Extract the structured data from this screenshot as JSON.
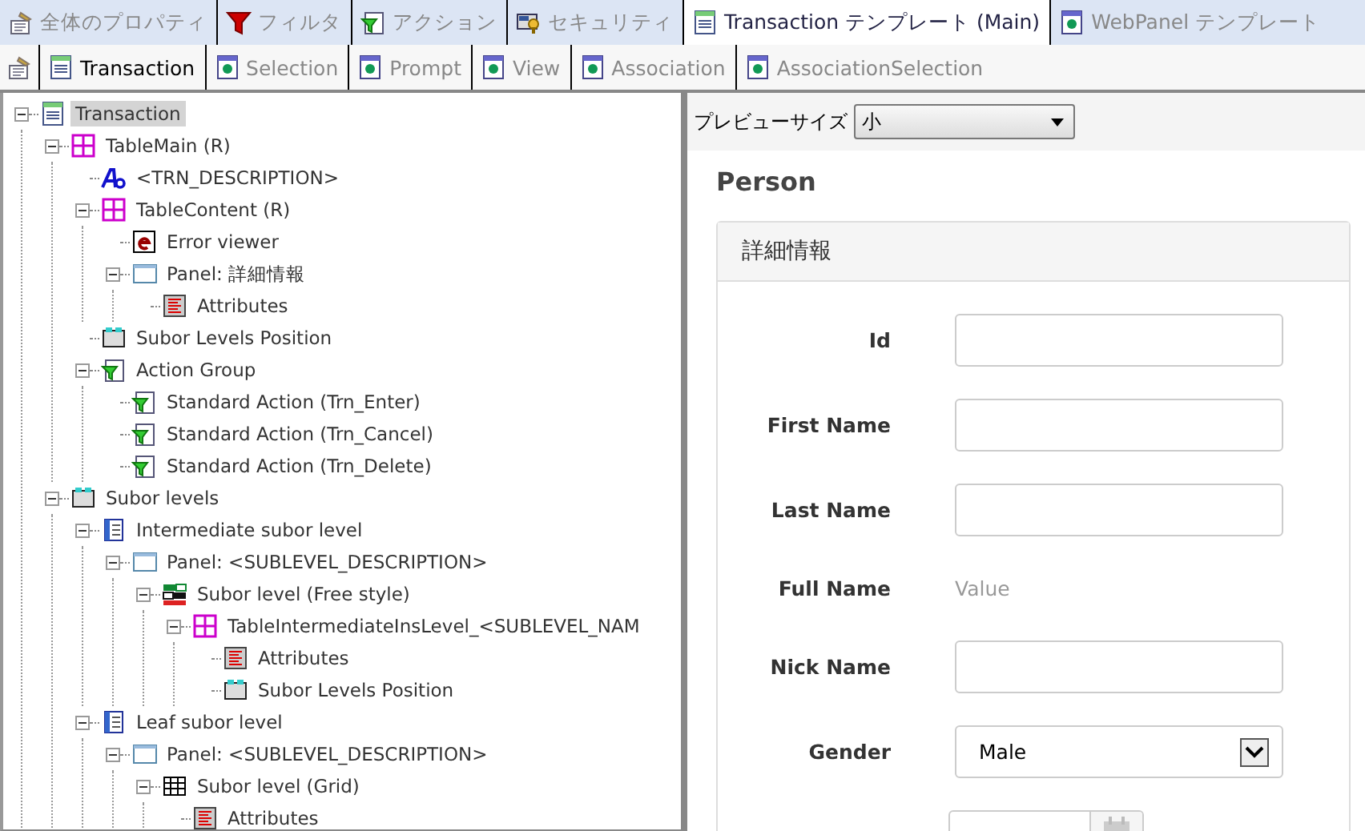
{
  "top_tabs": [
    {
      "label": "全体のプロパティ",
      "kind": "properties",
      "selected": false
    },
    {
      "label": "フィルタ",
      "kind": "filter",
      "selected": false
    },
    {
      "label": "アクション",
      "kind": "action",
      "selected": false
    },
    {
      "label": "セキュリティ",
      "kind": "security",
      "selected": false
    },
    {
      "label": "Transaction テンプレート (Main)",
      "kind": "transaction",
      "selected": true
    },
    {
      "label": "WebPanel テンプレート",
      "kind": "pattern",
      "selected": false
    }
  ],
  "sub_tabs": [
    {
      "label": "Transaction",
      "kind": "transaction",
      "selected": true
    },
    {
      "label": "Selection",
      "kind": "pattern",
      "selected": false
    },
    {
      "label": "Prompt",
      "kind": "pattern",
      "selected": false
    },
    {
      "label": "View",
      "kind": "pattern",
      "selected": false
    },
    {
      "label": "Association",
      "kind": "pattern",
      "selected": false
    },
    {
      "label": "AssociationSelection",
      "kind": "pattern",
      "selected": false
    }
  ],
  "tree": [
    {
      "label": "Transaction",
      "kind": "transaction",
      "selected": true,
      "expanded": true,
      "children": [
        {
          "label": "TableMain (R)",
          "kind": "table",
          "selected": false,
          "expanded": true,
          "children": [
            {
              "label": "<TRN_DESCRIPTION>",
              "kind": "textblock",
              "selected": false
            },
            {
              "label": "TableContent (R)",
              "kind": "table",
              "selected": false,
              "expanded": true,
              "children": [
                {
                  "label": "Error viewer",
                  "kind": "error",
                  "selected": false
                },
                {
                  "label": "Panel: 詳細情報",
                  "kind": "panel",
                  "selected": false,
                  "expanded": true,
                  "children": [
                    {
                      "label": "Attributes",
                      "kind": "attributes",
                      "selected": false
                    }
                  ]
                }
              ]
            },
            {
              "label": "Subor Levels Position",
              "kind": "levels",
              "selected": false
            },
            {
              "label": "Action Group",
              "kind": "action",
              "selected": false,
              "expanded": true,
              "children": [
                {
                  "label": "Standard Action (Trn_Enter)",
                  "kind": "action",
                  "selected": false
                },
                {
                  "label": "Standard Action (Trn_Cancel)",
                  "kind": "action",
                  "selected": false
                },
                {
                  "label": "Standard Action (Trn_Delete)",
                  "kind": "action",
                  "selected": false
                }
              ]
            }
          ]
        },
        {
          "label": "Subor levels",
          "kind": "levels",
          "selected": false,
          "expanded": true,
          "children": [
            {
              "label": "Intermediate subor level",
              "kind": "level",
              "selected": false,
              "expanded": true,
              "children": [
                {
                  "label": "Panel: <SUBLEVEL_DESCRIPTION>",
                  "kind": "panel",
                  "selected": false,
                  "expanded": true,
                  "children": [
                    {
                      "label": "Subor level (Free style)",
                      "kind": "freestyle",
                      "selected": false,
                      "expanded": true,
                      "children": [
                        {
                          "label": "TableIntermediateInsLevel_<SUBLEVEL_NAM",
                          "kind": "table",
                          "selected": false,
                          "expanded": true,
                          "children": [
                            {
                              "label": "Attributes",
                              "kind": "attributes",
                              "selected": false
                            },
                            {
                              "label": "Subor Levels Position",
                              "kind": "levels",
                              "selected": false
                            }
                          ]
                        }
                      ]
                    }
                  ]
                }
              ]
            },
            {
              "label": "Leaf subor level",
              "kind": "level",
              "selected": false,
              "expanded": true,
              "children": [
                {
                  "label": "Panel: <SUBLEVEL_DESCRIPTION>",
                  "kind": "panel",
                  "selected": false,
                  "expanded": true,
                  "children": [
                    {
                      "label": "Subor level (Grid)",
                      "kind": "grid",
                      "selected": false,
                      "expanded": true,
                      "children": [
                        {
                          "label": "Attributes",
                          "kind": "attributes",
                          "selected": false
                        }
                      ]
                    }
                  ]
                }
              ]
            }
          ]
        }
      ]
    }
  ],
  "preview": {
    "size_label": "プレビューサイズ",
    "size_value": "小",
    "title": "Person",
    "panel": {
      "title": "詳細情報",
      "fields": [
        {
          "label": "Id",
          "kind": "input"
        },
        {
          "label": "First Name",
          "kind": "input"
        },
        {
          "label": "Last Name",
          "kind": "input"
        },
        {
          "label": "Full Name",
          "kind": "text",
          "value": "Value"
        },
        {
          "label": "Nick Name",
          "kind": "input"
        },
        {
          "label": "Gender",
          "kind": "select",
          "value": "Male"
        },
        {
          "kind": "date"
        }
      ]
    }
  }
}
